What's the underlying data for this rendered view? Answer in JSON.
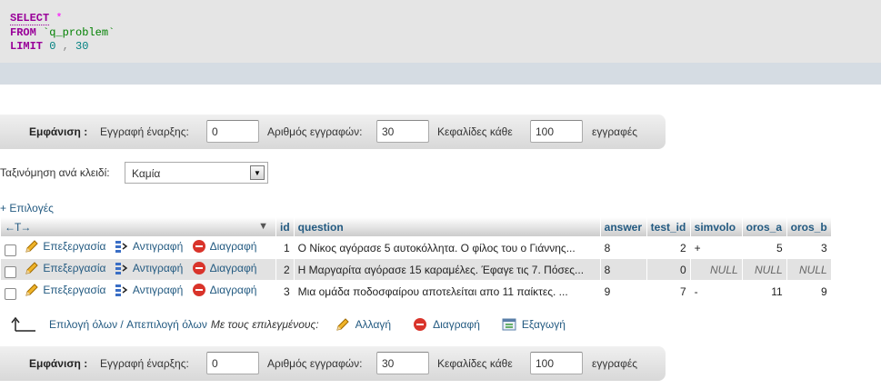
{
  "sql": {
    "select_kw": "SELECT",
    "star": "*",
    "from_kw": "FROM",
    "table": "`q_problem`",
    "limit_kw": "LIMIT",
    "limit_offset": "0",
    "comma": ",",
    "limit_count": "30"
  },
  "nav": {
    "show_label": "Εμφάνιση :",
    "start_label": "Εγγραφή έναρξης:",
    "start_value": "0",
    "count_label": "Αριθμός εγγραφών:",
    "count_value": "30",
    "headers_label": "Κεφαλίδες κάθε",
    "headers_value": "100",
    "records_label": "εγγραφές"
  },
  "nav_bottom": {
    "show_label": "Εμφάνιση :",
    "start_label": "Εγγραφή έναρξης:",
    "start_value": "0",
    "count_label": "Αριθμός εγγραφών:",
    "count_value": "30",
    "headers_label": "Κεφαλίδες κάθε",
    "headers_value": "100",
    "records_label": "εγγραφές"
  },
  "sort": {
    "label": "Ταξινόμηση ανά κλειδί:",
    "value": "Καμία"
  },
  "options_link": "+ Επιλογές",
  "table": {
    "arrows": "←T→",
    "headers": [
      "id",
      "question",
      "answer",
      "test_id",
      "simvolo",
      "oros_a",
      "oros_b"
    ],
    "actions": {
      "edit": "Επεξεργασία",
      "copy": "Αντιγραφή",
      "delete": "Διαγραφή"
    },
    "rows": [
      {
        "id": "1",
        "question": "Ο Νίκος αγόρασε 5 αυτοκόλλητα. Ο φίλος του ο Γιάννης...",
        "answer": "8",
        "test_id": "2",
        "simvolo": "+",
        "oros_a": "5",
        "oros_b": "3"
      },
      {
        "id": "2",
        "question": "Η Μαργαρίτα αγόρασε 15 καραμέλες. Έφαγε τις 7. Πόσες...",
        "answer": "8",
        "test_id": "0",
        "simvolo": "NULL",
        "oros_a": "NULL",
        "oros_b": "NULL"
      },
      {
        "id": "3",
        "question": "Μια ομάδα ποδοσφαίρου αποτελείται απο 11 παίκτες. ...",
        "answer": "9",
        "test_id": "7",
        "simvolo": "-",
        "oros_a": "11",
        "oros_b": "9"
      }
    ]
  },
  "bulk": {
    "check_all": "Επιλογή όλων",
    "separator": " / ",
    "uncheck_all": "Απεπιλογή όλων",
    "with_selected": "Με τους επιλεγμένους:",
    "change": "Αλλαγή",
    "delete": "Διαγραφή",
    "export": "Εξαγωγή"
  },
  "icons": {
    "edit": "pencil-icon",
    "copy": "copy-icon",
    "delete": "delete-icon",
    "export": "export-icon",
    "arrow": "corner-arrow-icon"
  },
  "colors": {
    "link": "#235a81",
    "keyword": "#990099",
    "delete_red": "#d9342b",
    "row_even": "#e2e2e2"
  }
}
